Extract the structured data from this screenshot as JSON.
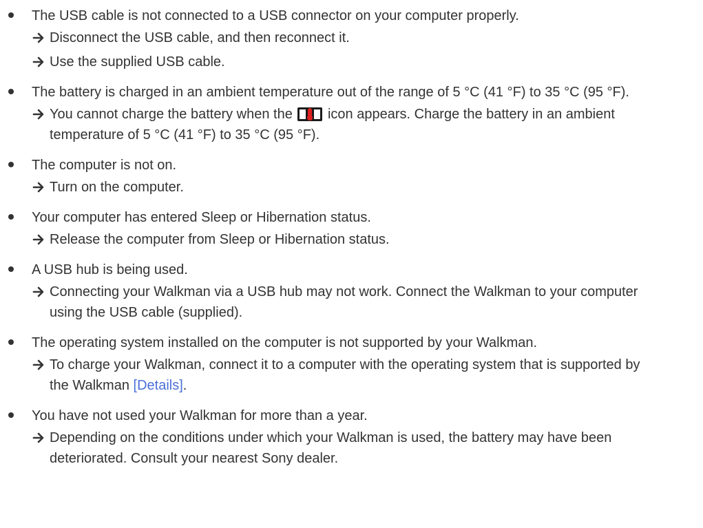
{
  "causes": [
    {
      "text": "The USB cable is not connected to a USB connector on your computer properly.",
      "remedies": [
        {
          "text": "Disconnect the USB cable, and then reconnect it."
        },
        {
          "text": "Use the supplied USB cable."
        }
      ]
    },
    {
      "text": "The battery is charged in an ambient temperature out of the range of 5 °C (41 °F) to 35 °C (95 °F).",
      "remedies": [
        {
          "before_icon": "You cannot charge the battery when the",
          "icon": "temperature-warning-icon",
          "after_icon": "icon appears. Charge the battery in an ambient temperature of 5 °C (41 °F) to 35 °C (95 °F)."
        }
      ]
    },
    {
      "text": "The computer is not on.",
      "remedies": [
        {
          "text": "Turn on the computer."
        }
      ]
    },
    {
      "text": "Your computer has entered Sleep or Hibernation status.",
      "remedies": [
        {
          "text": "Release the computer from Sleep or Hibernation status."
        }
      ]
    },
    {
      "text": "A USB hub is being used.",
      "remedies": [
        {
          "text": "Connecting your Walkman via a USB hub may not work. Connect the Walkman to your computer using the USB cable (supplied)."
        }
      ]
    },
    {
      "text": "The operating system installed on the computer is not supported by your Walkman.",
      "remedies": [
        {
          "before_link": "To charge your Walkman, connect it to a computer with the operating system that is supported by the Walkman",
          "link": "[Details]",
          "after_link": "."
        }
      ]
    },
    {
      "text": "You have not used your Walkman for more than a year.",
      "remedies": [
        {
          "text": "Depending on the conditions under which your Walkman is used, the battery may have been deteriorated. Consult your nearest Sony dealer."
        }
      ]
    }
  ],
  "colors": {
    "text": "#333333",
    "link": "#4a6fd8",
    "icon_red": "#e02020"
  }
}
